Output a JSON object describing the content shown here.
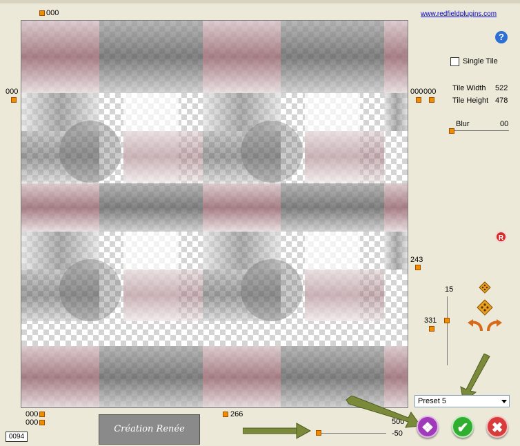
{
  "window": {
    "title_fragment": "..."
  },
  "top_handle": {
    "value": "000"
  },
  "left_handle": {
    "value": "000"
  },
  "right_handles": {
    "value_a": "000",
    "value_b": "000"
  },
  "link": {
    "text": "www.redfieldplugins.com"
  },
  "help": {
    "glyph": "?"
  },
  "single_tile": {
    "label": "Single Tile",
    "checked": false
  },
  "tile_width": {
    "label": "Tile Width",
    "value": "522"
  },
  "tile_height": {
    "label": "Tile Height",
    "value": "478"
  },
  "blur": {
    "label": "Blur",
    "value": "00"
  },
  "reset": {
    "glyph": "R"
  },
  "mid_right_handle": {
    "value": "243"
  },
  "vertical_slider": {
    "top_value": "15",
    "left_value": "331"
  },
  "bottom_left": {
    "value_a": "000",
    "value_b": "000"
  },
  "bottom_center_handle": {
    "value": "266"
  },
  "bottom_right_value": {
    "value": "500"
  },
  "bottom_slider": {
    "value": "-50"
  },
  "preset": {
    "selected": "Preset 5"
  },
  "signature": {
    "text": "Création Renée"
  },
  "counter": {
    "value": "0094"
  },
  "buttons": {
    "randomize": "❖",
    "ok": "✔",
    "cancel": "✖"
  },
  "colors": {
    "accent_orange": "#f08c00",
    "ok_green": "#2fae2f",
    "cancel_red": "#d93b3b",
    "random_purple": "#a13ab8",
    "annotation_olive": "#7b8a3a"
  }
}
